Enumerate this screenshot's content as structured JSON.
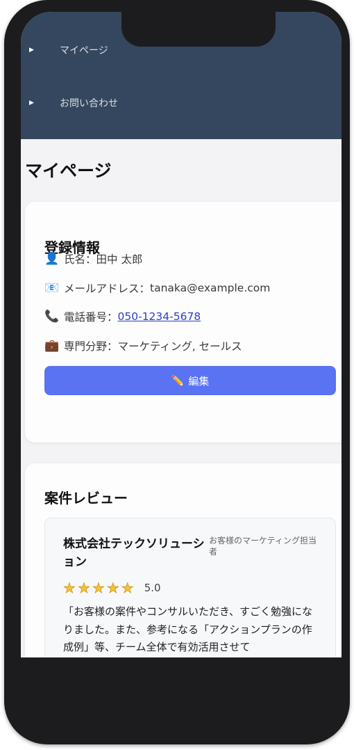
{
  "nav": {
    "items": [
      {
        "label": "マイページ"
      },
      {
        "label": "お問い合わせ"
      }
    ]
  },
  "page": {
    "title": "マイページ"
  },
  "profile": {
    "title": "登録情報",
    "rows": [
      {
        "icon": "user-icon",
        "label": "氏名：",
        "value": "田中 太郎"
      },
      {
        "icon": "mail-icon",
        "label": "メールアドレス：",
        "value": "tanaka@example.com"
      },
      {
        "icon": "phone-icon",
        "label": "電話番号：",
        "value": "050-1234-5678"
      },
      {
        "icon": "briefcase-icon",
        "label": "専門分野：",
        "value": "マーケティング, セールス"
      }
    ],
    "edit_label": "編集"
  },
  "reviews": {
    "title": "案件レビュー",
    "items": [
      {
        "company": "株式会社テックソリューション",
        "role": "お客様のマーケティング担当者",
        "rating": 5,
        "score": "5.0",
        "text": "「お客様の案件やコンサルいただき、すごく勉強になりました。また、参考になる「アクションプランの作成例」等、チーム全体で有効活用させて"
      }
    ]
  },
  "colors": {
    "nav_bg": "#35475e",
    "accent": "#5a73f2",
    "link": "#2a3ec7",
    "star": "#f6c534"
  }
}
